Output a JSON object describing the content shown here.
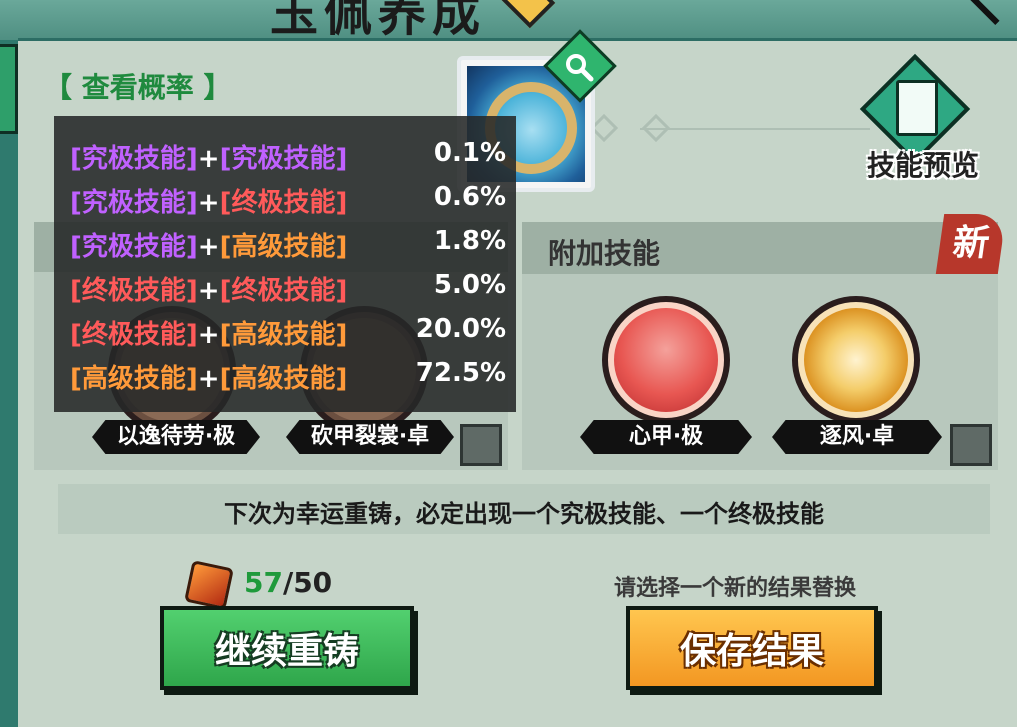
{
  "header": {
    "title": "玉佩养成"
  },
  "probability": {
    "link_label": "【 查看概率 】",
    "rows": [
      {
        "left": "[究极技能]",
        "left_tier": "a",
        "plus": "+",
        "right": "[究极技能]",
        "right_tier": "a",
        "pct": "0.1%"
      },
      {
        "left": "[究极技能]",
        "left_tier": "a",
        "plus": "+",
        "right": "[终极技能]",
        "right_tier": "u",
        "pct": "0.6%"
      },
      {
        "left": "[究极技能]",
        "left_tier": "a",
        "plus": "+",
        "right": "[高级技能]",
        "right_tier": "h",
        "pct": "1.8%"
      },
      {
        "left": "[终极技能]",
        "left_tier": "u",
        "plus": "+",
        "right": "[终极技能]",
        "right_tier": "u",
        "pct": "5.0%"
      },
      {
        "left": "[终极技能]",
        "left_tier": "u",
        "plus": "+",
        "right": "[高级技能]",
        "right_tier": "h",
        "pct": "20.0%"
      },
      {
        "left": "[高级技能]",
        "left_tier": "h",
        "plus": "+",
        "right": "[高级技能]",
        "right_tier": "h",
        "pct": "72.5%"
      }
    ]
  },
  "skill_preview": {
    "label": "技能预览"
  },
  "left_skills": [
    {
      "name": "以逸待劳·极"
    },
    {
      "name": "砍甲裂裳·卓"
    }
  ],
  "right_panel": {
    "title": "附加技能",
    "new_badge": "新",
    "skills": [
      {
        "name": "心甲·极"
      },
      {
        "name": "逐风·卓"
      }
    ]
  },
  "notice": "下次为幸运重铸，必定出现一个究极技能、一个终极技能",
  "counter": {
    "current": "57",
    "separator": "/",
    "max": "50"
  },
  "hint": "请选择一个新的结果替换",
  "buttons": {
    "recast": "继续重铸",
    "save": "保存结果"
  },
  "colors": {
    "ultimate": "#c061ff",
    "final": "#ff5a5a",
    "advanced": "#ff9a3a",
    "count_current": "#1f9a3b"
  }
}
